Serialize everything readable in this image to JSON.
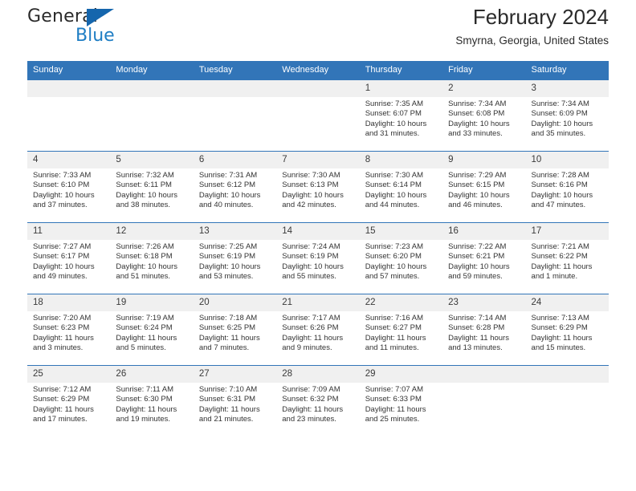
{
  "brand": {
    "name_top": "General",
    "name_bottom": "Blue",
    "triangle_color": "#1566ad",
    "blue_text_color": "#1f7ec4"
  },
  "header": {
    "title": "February 2024",
    "subtitle": "Smyrna, Georgia, United States",
    "header_bg_color": "#3275b8",
    "daynum_bg_color": "#f0f0f0"
  },
  "weekday_headers": [
    "Sunday",
    "Monday",
    "Tuesday",
    "Wednesday",
    "Thursday",
    "Friday",
    "Saturday"
  ],
  "weeks": [
    [
      {
        "day": "",
        "sunrise": "",
        "sunset": "",
        "daylight1": "",
        "daylight2": ""
      },
      {
        "day": "",
        "sunrise": "",
        "sunset": "",
        "daylight1": "",
        "daylight2": ""
      },
      {
        "day": "",
        "sunrise": "",
        "sunset": "",
        "daylight1": "",
        "daylight2": ""
      },
      {
        "day": "",
        "sunrise": "",
        "sunset": "",
        "daylight1": "",
        "daylight2": ""
      },
      {
        "day": "1",
        "sunrise": "Sunrise: 7:35 AM",
        "sunset": "Sunset: 6:07 PM",
        "daylight1": "Daylight: 10 hours",
        "daylight2": "and 31 minutes."
      },
      {
        "day": "2",
        "sunrise": "Sunrise: 7:34 AM",
        "sunset": "Sunset: 6:08 PM",
        "daylight1": "Daylight: 10 hours",
        "daylight2": "and 33 minutes."
      },
      {
        "day": "3",
        "sunrise": "Sunrise: 7:34 AM",
        "sunset": "Sunset: 6:09 PM",
        "daylight1": "Daylight: 10 hours",
        "daylight2": "and 35 minutes."
      }
    ],
    [
      {
        "day": "4",
        "sunrise": "Sunrise: 7:33 AM",
        "sunset": "Sunset: 6:10 PM",
        "daylight1": "Daylight: 10 hours",
        "daylight2": "and 37 minutes."
      },
      {
        "day": "5",
        "sunrise": "Sunrise: 7:32 AM",
        "sunset": "Sunset: 6:11 PM",
        "daylight1": "Daylight: 10 hours",
        "daylight2": "and 38 minutes."
      },
      {
        "day": "6",
        "sunrise": "Sunrise: 7:31 AM",
        "sunset": "Sunset: 6:12 PM",
        "daylight1": "Daylight: 10 hours",
        "daylight2": "and 40 minutes."
      },
      {
        "day": "7",
        "sunrise": "Sunrise: 7:30 AM",
        "sunset": "Sunset: 6:13 PM",
        "daylight1": "Daylight: 10 hours",
        "daylight2": "and 42 minutes."
      },
      {
        "day": "8",
        "sunrise": "Sunrise: 7:30 AM",
        "sunset": "Sunset: 6:14 PM",
        "daylight1": "Daylight: 10 hours",
        "daylight2": "and 44 minutes."
      },
      {
        "day": "9",
        "sunrise": "Sunrise: 7:29 AM",
        "sunset": "Sunset: 6:15 PM",
        "daylight1": "Daylight: 10 hours",
        "daylight2": "and 46 minutes."
      },
      {
        "day": "10",
        "sunrise": "Sunrise: 7:28 AM",
        "sunset": "Sunset: 6:16 PM",
        "daylight1": "Daylight: 10 hours",
        "daylight2": "and 47 minutes."
      }
    ],
    [
      {
        "day": "11",
        "sunrise": "Sunrise: 7:27 AM",
        "sunset": "Sunset: 6:17 PM",
        "daylight1": "Daylight: 10 hours",
        "daylight2": "and 49 minutes."
      },
      {
        "day": "12",
        "sunrise": "Sunrise: 7:26 AM",
        "sunset": "Sunset: 6:18 PM",
        "daylight1": "Daylight: 10 hours",
        "daylight2": "and 51 minutes."
      },
      {
        "day": "13",
        "sunrise": "Sunrise: 7:25 AM",
        "sunset": "Sunset: 6:19 PM",
        "daylight1": "Daylight: 10 hours",
        "daylight2": "and 53 minutes."
      },
      {
        "day": "14",
        "sunrise": "Sunrise: 7:24 AM",
        "sunset": "Sunset: 6:19 PM",
        "daylight1": "Daylight: 10 hours",
        "daylight2": "and 55 minutes."
      },
      {
        "day": "15",
        "sunrise": "Sunrise: 7:23 AM",
        "sunset": "Sunset: 6:20 PM",
        "daylight1": "Daylight: 10 hours",
        "daylight2": "and 57 minutes."
      },
      {
        "day": "16",
        "sunrise": "Sunrise: 7:22 AM",
        "sunset": "Sunset: 6:21 PM",
        "daylight1": "Daylight: 10 hours",
        "daylight2": "and 59 minutes."
      },
      {
        "day": "17",
        "sunrise": "Sunrise: 7:21 AM",
        "sunset": "Sunset: 6:22 PM",
        "daylight1": "Daylight: 11 hours",
        "daylight2": "and 1 minute."
      }
    ],
    [
      {
        "day": "18",
        "sunrise": "Sunrise: 7:20 AM",
        "sunset": "Sunset: 6:23 PM",
        "daylight1": "Daylight: 11 hours",
        "daylight2": "and 3 minutes."
      },
      {
        "day": "19",
        "sunrise": "Sunrise: 7:19 AM",
        "sunset": "Sunset: 6:24 PM",
        "daylight1": "Daylight: 11 hours",
        "daylight2": "and 5 minutes."
      },
      {
        "day": "20",
        "sunrise": "Sunrise: 7:18 AM",
        "sunset": "Sunset: 6:25 PM",
        "daylight1": "Daylight: 11 hours",
        "daylight2": "and 7 minutes."
      },
      {
        "day": "21",
        "sunrise": "Sunrise: 7:17 AM",
        "sunset": "Sunset: 6:26 PM",
        "daylight1": "Daylight: 11 hours",
        "daylight2": "and 9 minutes."
      },
      {
        "day": "22",
        "sunrise": "Sunrise: 7:16 AM",
        "sunset": "Sunset: 6:27 PM",
        "daylight1": "Daylight: 11 hours",
        "daylight2": "and 11 minutes."
      },
      {
        "day": "23",
        "sunrise": "Sunrise: 7:14 AM",
        "sunset": "Sunset: 6:28 PM",
        "daylight1": "Daylight: 11 hours",
        "daylight2": "and 13 minutes."
      },
      {
        "day": "24",
        "sunrise": "Sunrise: 7:13 AM",
        "sunset": "Sunset: 6:29 PM",
        "daylight1": "Daylight: 11 hours",
        "daylight2": "and 15 minutes."
      }
    ],
    [
      {
        "day": "25",
        "sunrise": "Sunrise: 7:12 AM",
        "sunset": "Sunset: 6:29 PM",
        "daylight1": "Daylight: 11 hours",
        "daylight2": "and 17 minutes."
      },
      {
        "day": "26",
        "sunrise": "Sunrise: 7:11 AM",
        "sunset": "Sunset: 6:30 PM",
        "daylight1": "Daylight: 11 hours",
        "daylight2": "and 19 minutes."
      },
      {
        "day": "27",
        "sunrise": "Sunrise: 7:10 AM",
        "sunset": "Sunset: 6:31 PM",
        "daylight1": "Daylight: 11 hours",
        "daylight2": "and 21 minutes."
      },
      {
        "day": "28",
        "sunrise": "Sunrise: 7:09 AM",
        "sunset": "Sunset: 6:32 PM",
        "daylight1": "Daylight: 11 hours",
        "daylight2": "and 23 minutes."
      },
      {
        "day": "29",
        "sunrise": "Sunrise: 7:07 AM",
        "sunset": "Sunset: 6:33 PM",
        "daylight1": "Daylight: 11 hours",
        "daylight2": "and 25 minutes."
      },
      {
        "day": "",
        "sunrise": "",
        "sunset": "",
        "daylight1": "",
        "daylight2": ""
      },
      {
        "day": "",
        "sunrise": "",
        "sunset": "",
        "daylight1": "",
        "daylight2": ""
      }
    ]
  ]
}
